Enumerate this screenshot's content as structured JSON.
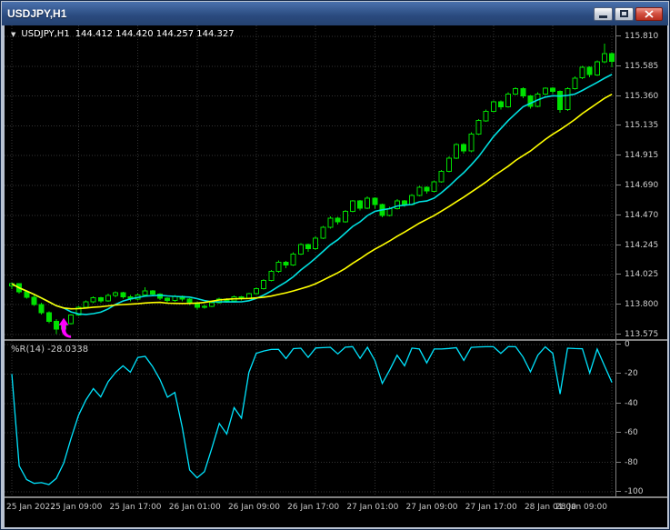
{
  "window": {
    "title": "USDJPY,H1"
  },
  "header": {
    "symbol": "USDJPY,H1",
    "ohlc": "144.412 144.420 144.257 144.327"
  },
  "colors": {
    "background": "#000000",
    "grid": "#343434",
    "candle": "#00e000",
    "bull_fill": "#000000",
    "axis_text": "#d0d0d0",
    "panel_divider": "#808080",
    "marker": "#ff00ff"
  },
  "chart_data": {
    "type": "candlestick",
    "symbol": "USDJPY",
    "timeframe": "H1",
    "price_axis": {
      "max": 115.81,
      "min": 113.575,
      "labels": [
        "115.810",
        "115.585",
        "115.360",
        "115.135",
        "114.915",
        "114.690",
        "114.470",
        "114.245",
        "114.025",
        "113.800",
        "113.575"
      ]
    },
    "time_axis": {
      "labels": [
        "25 Jan 2022",
        "25 Jan 09:00",
        "25 Jan 17:00",
        "26 Jan 01:00",
        "26 Jan 09:00",
        "26 Jan 17:00",
        "27 Jan 01:00",
        "27 Jan 09:00",
        "27 Jan 17:00",
        "28 Jan 01:00",
        "28 Jan 09:00"
      ],
      "bar_indices": [
        0,
        9,
        17,
        25,
        33,
        41,
        49,
        57,
        65,
        73,
        81
      ]
    },
    "candles": [
      [
        113.94,
        113.965,
        113.915,
        113.955
      ],
      [
        113.955,
        113.96,
        113.88,
        113.895
      ],
      [
        113.895,
        113.905,
        113.845,
        113.855
      ],
      [
        113.855,
        113.87,
        113.79,
        113.8
      ],
      [
        113.8,
        113.815,
        113.725,
        113.74
      ],
      [
        113.74,
        113.75,
        113.66,
        113.675
      ],
      [
        113.675,
        113.69,
        113.58,
        113.615
      ],
      [
        113.615,
        113.67,
        113.585,
        113.655
      ],
      [
        113.655,
        113.73,
        113.65,
        113.72
      ],
      [
        113.72,
        113.79,
        113.715,
        113.78
      ],
      [
        113.78,
        113.83,
        113.77,
        113.82
      ],
      [
        113.82,
        113.86,
        113.81,
        113.85
      ],
      [
        113.85,
        113.858,
        113.815,
        113.828
      ],
      [
        113.828,
        113.88,
        113.82,
        113.868
      ],
      [
        113.868,
        113.9,
        113.855,
        113.888
      ],
      [
        113.888,
        113.895,
        113.845,
        113.858
      ],
      [
        113.858,
        113.87,
        113.825,
        113.84
      ],
      [
        113.84,
        113.882,
        113.832,
        113.872
      ],
      [
        113.872,
        113.93,
        113.865,
        113.902
      ],
      [
        113.902,
        113.91,
        113.862,
        113.878
      ],
      [
        113.878,
        113.885,
        113.835,
        113.848
      ],
      [
        113.848,
        113.856,
        113.815,
        113.83
      ],
      [
        113.83,
        113.87,
        113.822,
        113.86
      ],
      [
        113.86,
        113.868,
        113.825,
        113.84
      ],
      [
        113.84,
        113.848,
        113.795,
        113.815
      ],
      [
        113.815,
        113.822,
        113.762,
        113.778
      ],
      [
        113.778,
        113.8,
        113.768,
        113.785
      ],
      [
        113.785,
        113.822,
        113.778,
        113.812
      ],
      [
        113.812,
        113.85,
        113.805,
        113.84
      ],
      [
        113.84,
        113.848,
        113.812,
        113.828
      ],
      [
        113.828,
        113.868,
        113.82,
        113.858
      ],
      [
        113.858,
        113.866,
        113.83,
        113.846
      ],
      [
        113.846,
        113.89,
        113.84,
        113.882
      ],
      [
        113.882,
        113.93,
        113.875,
        113.92
      ],
      [
        113.92,
        113.99,
        113.912,
        113.98
      ],
      [
        113.98,
        114.06,
        113.972,
        114.05
      ],
      [
        114.05,
        114.13,
        114.04,
        114.118
      ],
      [
        114.118,
        114.128,
        114.072,
        114.095
      ],
      [
        114.095,
        114.19,
        114.088,
        114.178
      ],
      [
        114.178,
        114.26,
        114.17,
        114.248
      ],
      [
        114.248,
        114.258,
        114.195,
        114.218
      ],
      [
        114.218,
        114.31,
        114.21,
        114.298
      ],
      [
        114.298,
        114.39,
        114.29,
        114.378
      ],
      [
        114.378,
        114.46,
        114.37,
        114.448
      ],
      [
        114.448,
        114.458,
        114.398,
        114.42
      ],
      [
        114.42,
        114.51,
        114.412,
        114.498
      ],
      [
        114.498,
        114.585,
        114.49,
        114.575
      ],
      [
        114.575,
        114.582,
        114.505,
        114.522
      ],
      [
        114.522,
        114.61,
        114.515,
        114.598
      ],
      [
        114.598,
        114.605,
        114.52,
        114.548
      ],
      [
        114.548,
        114.556,
        114.455,
        114.468
      ],
      [
        114.468,
        114.532,
        114.46,
        114.52
      ],
      [
        114.52,
        114.59,
        114.512,
        114.578
      ],
      [
        114.578,
        114.585,
        114.532,
        114.55
      ],
      [
        114.55,
        114.628,
        114.542,
        114.618
      ],
      [
        114.618,
        114.69,
        114.61,
        114.678
      ],
      [
        114.678,
        114.685,
        114.63,
        114.65
      ],
      [
        114.65,
        114.73,
        114.642,
        114.72
      ],
      [
        114.72,
        114.81,
        114.712,
        114.798
      ],
      [
        114.798,
        114.91,
        114.79,
        114.898
      ],
      [
        114.898,
        115.01,
        114.89,
        114.998
      ],
      [
        114.998,
        115.008,
        114.93,
        114.95
      ],
      [
        114.95,
        115.09,
        114.942,
        115.078
      ],
      [
        115.078,
        115.19,
        115.07,
        115.178
      ],
      [
        115.178,
        115.26,
        115.17,
        115.248
      ],
      [
        115.248,
        115.33,
        115.24,
        115.318
      ],
      [
        115.318,
        115.328,
        115.262,
        115.282
      ],
      [
        115.282,
        115.39,
        115.275,
        115.378
      ],
      [
        115.378,
        115.43,
        115.37,
        115.418
      ],
      [
        115.418,
        115.428,
        115.345,
        115.362
      ],
      [
        115.362,
        115.37,
        115.268,
        115.284
      ],
      [
        115.284,
        115.39,
        115.278,
        115.378
      ],
      [
        115.378,
        115.43,
        115.37,
        115.42
      ],
      [
        115.42,
        115.428,
        115.38,
        115.398
      ],
      [
        115.398,
        115.405,
        115.238,
        115.262
      ],
      [
        115.262,
        115.43,
        115.25,
        115.418
      ],
      [
        115.418,
        115.51,
        115.41,
        115.498
      ],
      [
        115.498,
        115.59,
        115.49,
        115.578
      ],
      [
        115.578,
        115.585,
        115.505,
        115.522
      ],
      [
        115.522,
        115.63,
        115.515,
        115.618
      ],
      [
        115.618,
        115.755,
        115.61,
        115.68
      ],
      [
        115.68,
        115.692,
        115.578,
        115.622
      ]
    ],
    "overlays": [
      {
        "name": "fast-ma",
        "period": 8,
        "color": "#00e0e0"
      },
      {
        "name": "slow-ma",
        "period": 21,
        "color": "#ffff00"
      }
    ],
    "indicator": {
      "name": "Williams %R",
      "label": "%R(14) -28.0338",
      "period": 14,
      "color": "#00e5ff",
      "axis_labels": [
        "0",
        "-20",
        "-40",
        "-60",
        "-80",
        "-100"
      ],
      "range": [
        0,
        -100
      ]
    },
    "marker": {
      "name": "buy-arrow",
      "color": "#ff00ff",
      "bar": 7,
      "price": 113.7
    }
  }
}
